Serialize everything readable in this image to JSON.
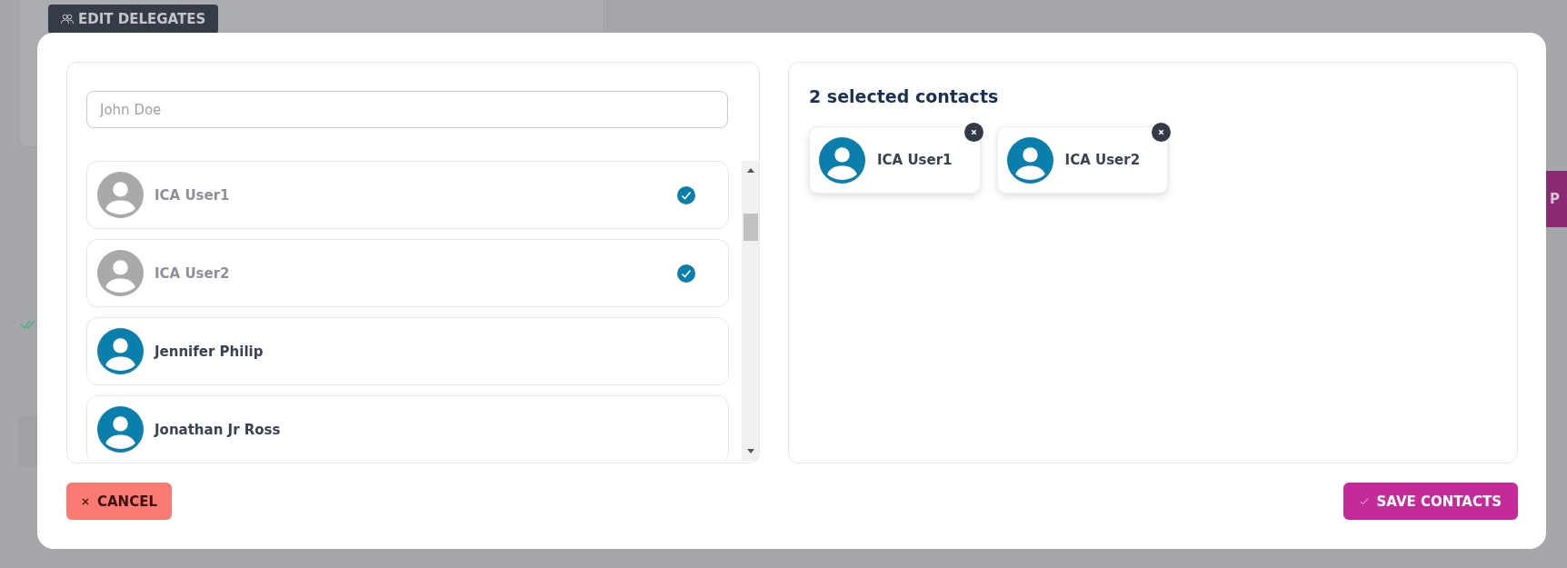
{
  "background": {
    "edit_button": {
      "label": "EDIT DELEGATES"
    },
    "side_button": {
      "label": "P"
    }
  },
  "modal": {
    "search": {
      "placeholder": "John Doe"
    },
    "contacts": [
      {
        "name": "ICA User1",
        "selected": true
      },
      {
        "name": "ICA User2",
        "selected": true
      },
      {
        "name": "Jennifer Philip",
        "selected": false
      },
      {
        "name": "Jonathan Jr Ross",
        "selected": false
      }
    ],
    "selected_title": "2 selected contacts",
    "chips": [
      {
        "name": "ICA User1"
      },
      {
        "name": "ICA User2"
      }
    ],
    "cancel_button": {
      "label": "CANCEL"
    },
    "save_button": {
      "label": "SAVE CONTACTS"
    }
  }
}
